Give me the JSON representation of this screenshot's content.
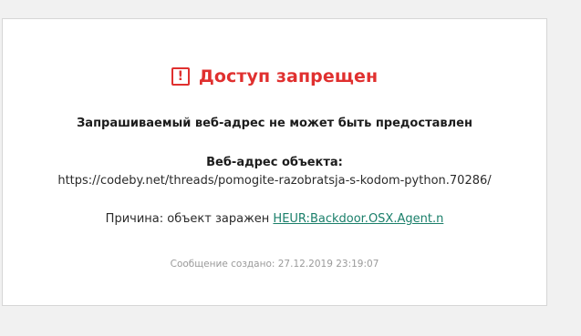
{
  "header": {
    "icon": "warning-icon",
    "icon_glyph": "!",
    "title": "Доступ запрещен",
    "color": "#e0302f"
  },
  "message": {
    "headline": "Запрашиваемый веб-адрес не может быть предоставлен",
    "address_label": "Веб-адрес объекта:",
    "address_value": "https://codeby.net/threads/pomogite-razobratsja-s-kodom-python.70286/",
    "reason_label": "Причина: объект заражен",
    "reason_threat": "HEUR:Backdoor.OSX.Agent.n",
    "link_color": "#1a7f6a"
  },
  "footer": {
    "created": "Сообщение создано: 27.12.2019 23:19:07"
  }
}
